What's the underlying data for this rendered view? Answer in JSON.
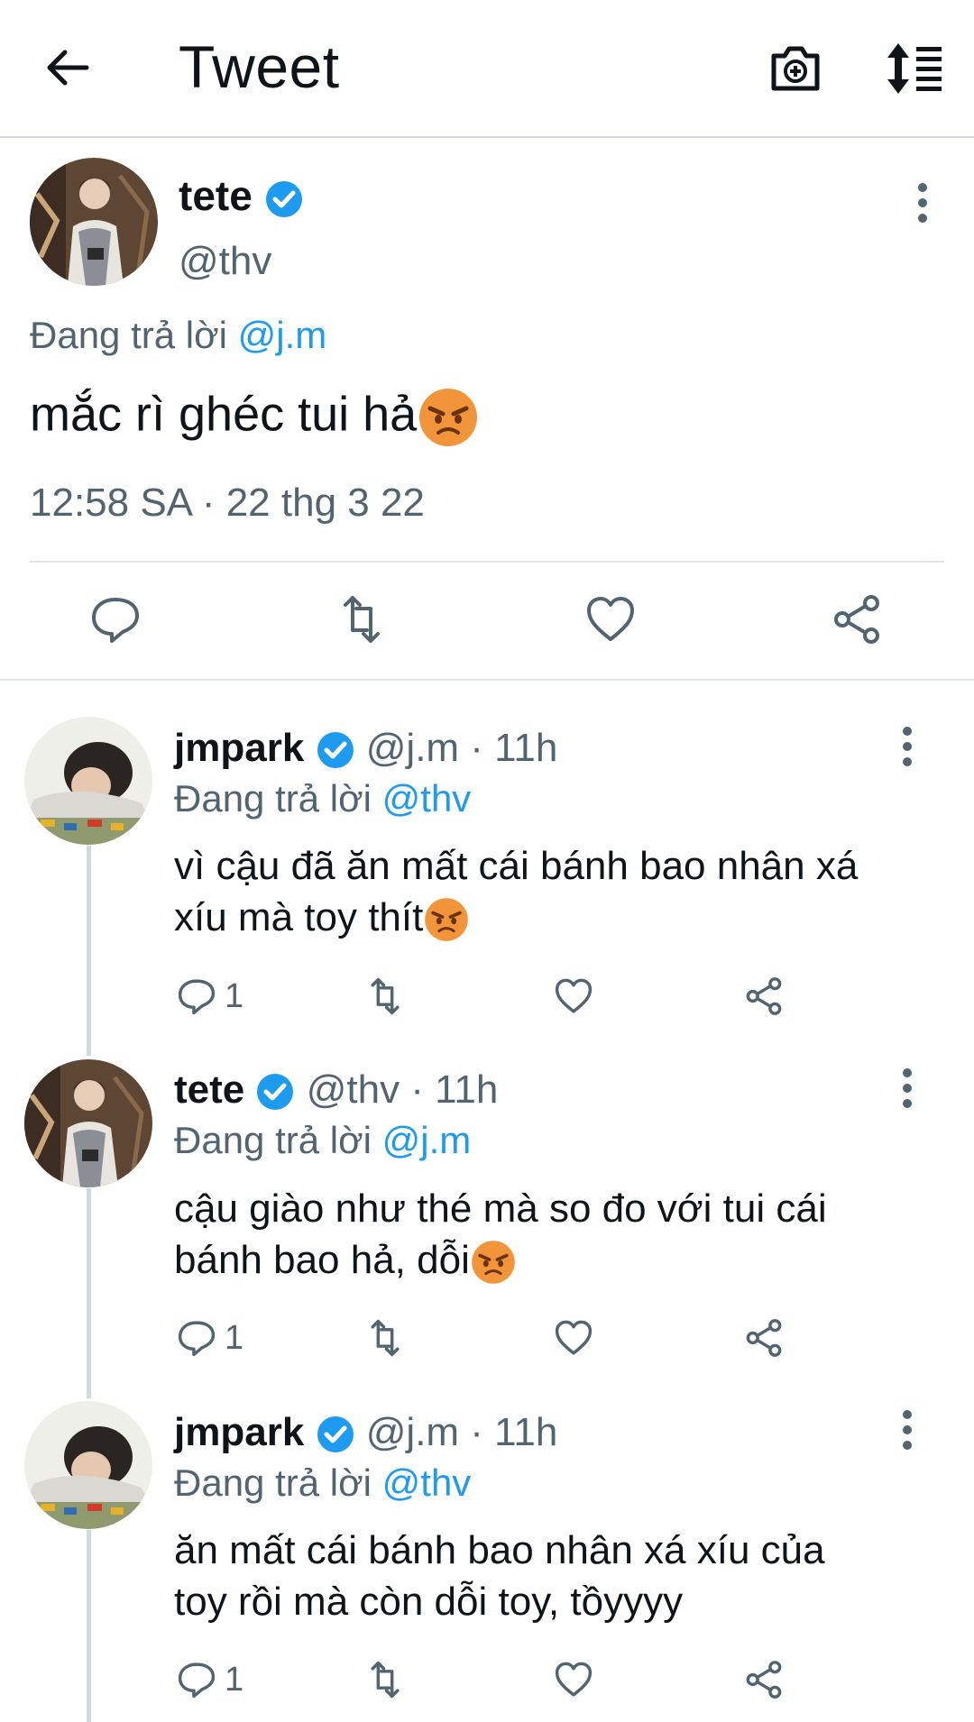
{
  "header": {
    "title": "Tweet",
    "back_icon": "arrow-left-icon",
    "camera_icon": "camera-plus-icon",
    "sort_icon": "sort-order-icon"
  },
  "main_tweet": {
    "name": "tete",
    "handle": "@thv",
    "replying_label": "Đang trả lời",
    "replying_to": "@j.m",
    "text": "mắc rì ghéc tui hả",
    "timestamp": "12:58 SA · 22 thg 3 22"
  },
  "replies": [
    {
      "name": "jmpark",
      "meta": "@j.m · 11h",
      "replying_label": "Đang trả lời",
      "replying_to": "@thv",
      "line1": "vì cậu đã ăn mất cái bánh bao nhân xá",
      "line2": "xíu mà toy thít",
      "reply_count": "1"
    },
    {
      "name": "tete",
      "meta": "@thv · 11h",
      "replying_label": "Đang trả lời",
      "replying_to": "@j.m",
      "line1": "cậu giào như thé mà so đo với tui cái",
      "line2": "bánh bao hả, dỗi",
      "reply_count": "1"
    },
    {
      "name": "jmpark",
      "meta": "@j.m · 11h",
      "replying_label": "Đang trả lời",
      "replying_to": "@thv",
      "line1": "ăn mất cái bánh bao nhân xá xíu của",
      "line2": "toy rồi mà còn dỗi toy, tồyyyy",
      "reply_count": "1"
    }
  ],
  "colors": {
    "accent": "#1d9bf0",
    "secondary_text": "#536471",
    "angry_emoji": "#f2953a"
  }
}
